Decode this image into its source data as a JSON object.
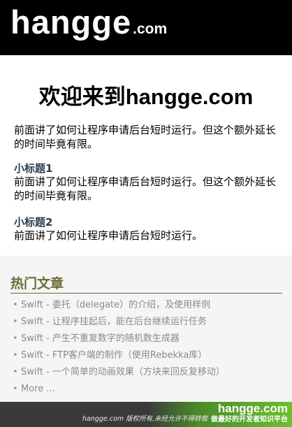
{
  "header": {
    "logo_main": "hangge",
    "logo_tld": ".com"
  },
  "main": {
    "title": "欢迎来到hangge.com",
    "intro": "前面讲了如何让程序申请后台短时运行。但这个额外延长的时间毕竟有限。",
    "sections": [
      {
        "heading": "小标题1",
        "text": "前面讲了如何让程序申请后台短时运行。但这个额外延长的时间毕竟有限。"
      },
      {
        "heading": "小标题2",
        "text": "前面讲了如何让程序申请后台短时运行。"
      }
    ]
  },
  "hot": {
    "title": "热门文章",
    "bullet": "•",
    "items": [
      "Swift - 委托（delegate）的介绍，及使用样例",
      "Swift - 让程序挂起后，能在后台继续运行任务",
      "Swift - 产生不重复数字的随机数生成器",
      "Swift - FTP客户端的制作（使用Rebekka库）",
      "Swift - 一个简单的动画效果（方块来回反复移动）",
      "More ..."
    ]
  },
  "footer": {
    "copyright": "hangge.com 版权所有,未经允许不得转载",
    "watermark_title": "hangge.com",
    "watermark_sub": "做最好的开发者知识平台"
  },
  "colors": {
    "header_bg": "#000000",
    "section_heading": "#2c3e50",
    "hot_title": "#6b6a3a",
    "footer_bg": "#3a3a3a",
    "footer_green": "#6cc030"
  }
}
